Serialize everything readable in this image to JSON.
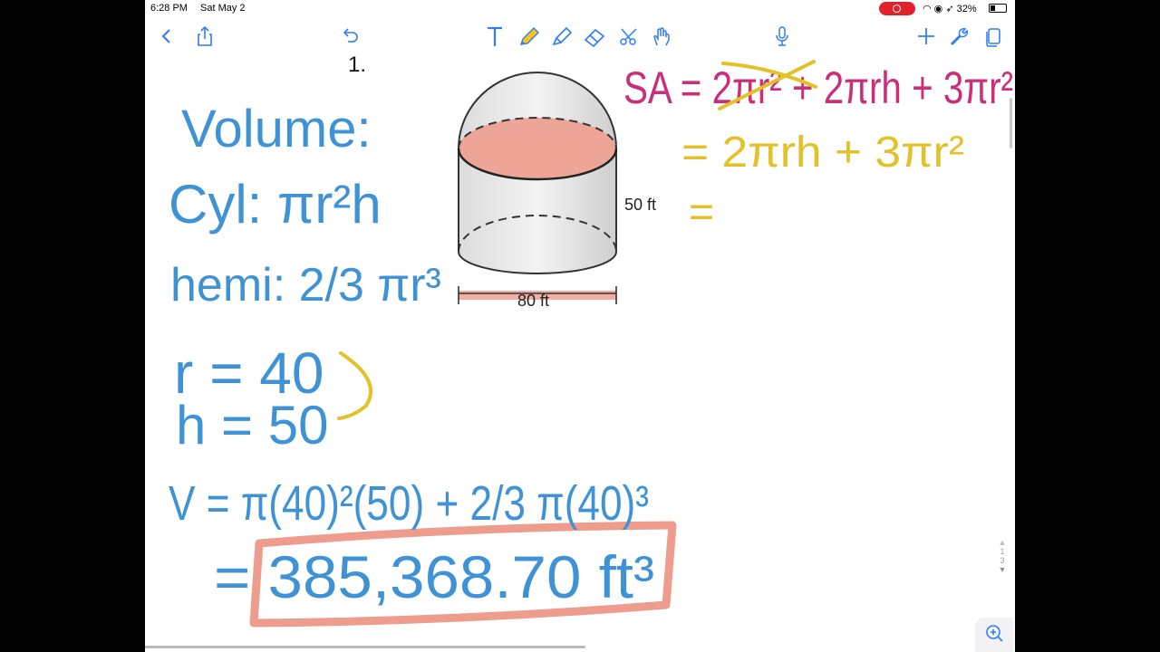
{
  "status_bar": {
    "time": "6:28 PM",
    "date": "Sat May 2",
    "battery": "32%",
    "battery_level": 0.32
  },
  "toolbar": {
    "left": [
      {
        "name": "back-chevron-icon"
      },
      {
        "name": "share-icon"
      }
    ],
    "center": [
      {
        "name": "undo-icon"
      },
      {
        "name": "text-tool-icon"
      },
      {
        "name": "pen-tool-icon",
        "selected": true
      },
      {
        "name": "highlighter-icon"
      },
      {
        "name": "eraser-icon"
      },
      {
        "name": "lasso-scissors-icon"
      },
      {
        "name": "gesture-hand-icon"
      }
    ],
    "right": [
      {
        "name": "microphone-icon"
      },
      {
        "name": "add-icon"
      },
      {
        "name": "wrench-icon"
      },
      {
        "name": "pages-icon"
      }
    ]
  },
  "note": {
    "problem_number": "1.",
    "figure": {
      "height_label": "50 ft",
      "width_label": "80 ft"
    },
    "handwriting": {
      "volume_title": "Volume:",
      "cyl_formula": "Cyl: πr²h",
      "hemi_formula": "hemi: 2/3 πr³",
      "r_value": "r = 40",
      "h_value": "h = 50",
      "v_equation": "V = π(40)²(50) + 2/3 π(40)³",
      "result": "= 385,368.70 ft³",
      "sa_line1": "SA = 2πr² + 2πrh + 3πr²",
      "sa_line2": "= 2πrh + 3πr²",
      "sa_line3": "="
    }
  },
  "pager": {
    "current": "1",
    "total": "3"
  },
  "colors": {
    "blue_ink": "#3f93d4",
    "magenta_ink": "#cc2f79",
    "yellow_ink": "#e3c12a",
    "salmon": "#ee9c8e"
  }
}
